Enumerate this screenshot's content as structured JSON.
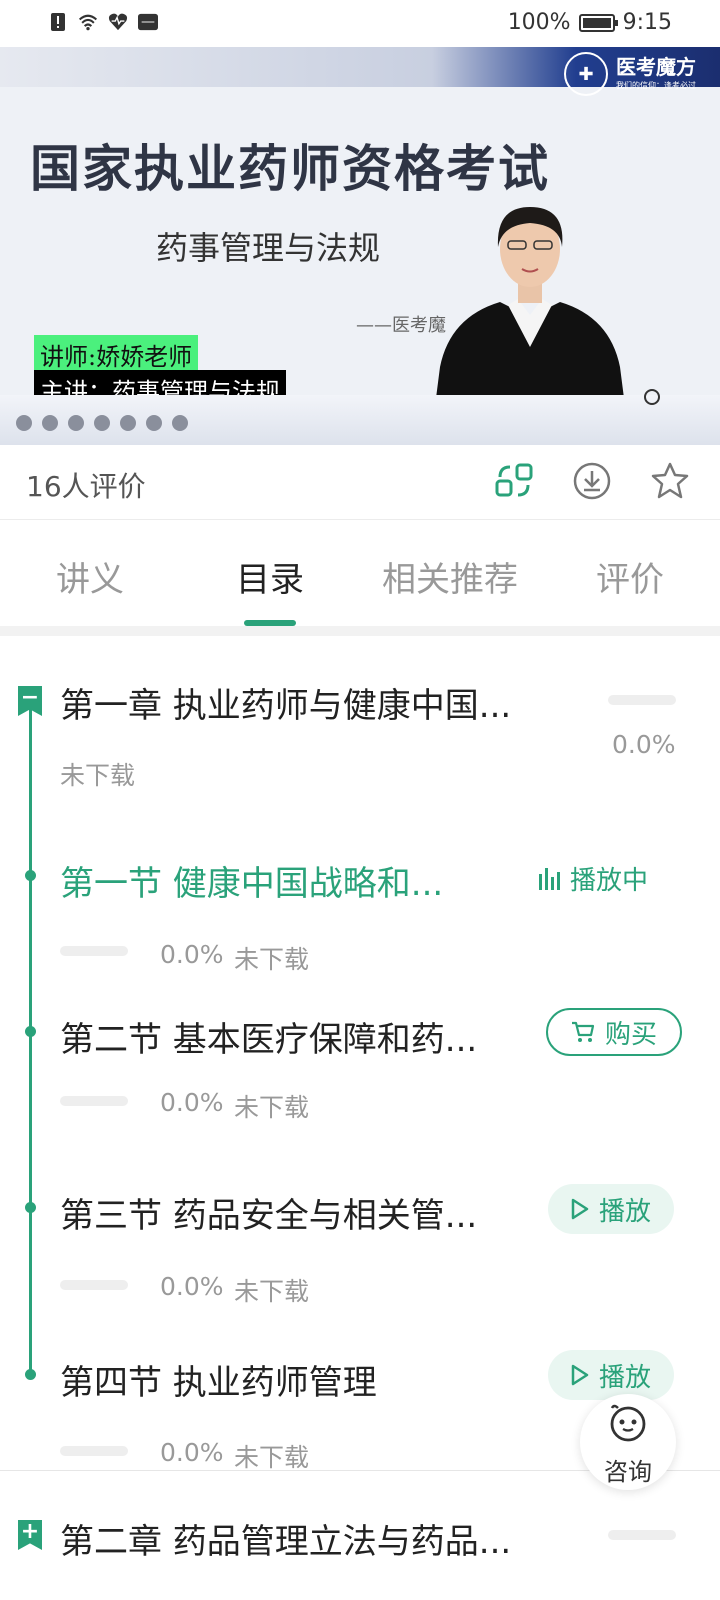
{
  "status": {
    "battery_percent": "100%",
    "time": "9:15"
  },
  "video": {
    "brand_name": "医考魔方",
    "brand_slogan": "我们的信仰：逢考必过",
    "title": "国家执业药师资格考试",
    "subtitle": "药事管理与法规",
    "attribution": "——医考魔",
    "lecturer_label": "讲师:娇娇老师",
    "lecture_label": "主讲：药事管理与法规"
  },
  "rating": {
    "text": "16人评价",
    "icons": [
      "switch-icon",
      "download-icon",
      "star-icon"
    ]
  },
  "tabs": [
    {
      "label": "讲义"
    },
    {
      "label": "目录",
      "active": true
    },
    {
      "label": "相关推荐"
    },
    {
      "label": "评价"
    }
  ],
  "catalog": {
    "chapter1": {
      "title": "第一章 执业药师与健康中国...",
      "percent": "0.0%",
      "download_status": "未下载",
      "collapse_symbol": "−"
    },
    "sections": [
      {
        "title": "第一节 健康中国战略和...",
        "percent": "0.0%",
        "download_status": "未下载",
        "action": "播放中",
        "state": "playing"
      },
      {
        "title": "第二节 基本医疗保障和药...",
        "percent": "0.0%",
        "download_status": "未下载",
        "action": "购买",
        "state": "buy"
      },
      {
        "title": "第三节 药品安全与相关管...",
        "percent": "0.0%",
        "download_status": "未下载",
        "action": "播放",
        "state": "play"
      },
      {
        "title": "第四节 执业药师管理",
        "percent": "0.0%",
        "download_status": "未下载",
        "action": "播放",
        "state": "play"
      }
    ],
    "chapter2": {
      "title": "第二章 药品管理立法与药品...",
      "expand_symbol": "+"
    }
  },
  "consult": {
    "label": "咨询"
  },
  "colors": {
    "accent": "#2aa27a",
    "muted": "#999999",
    "highlight_green": "#4bf07d"
  }
}
